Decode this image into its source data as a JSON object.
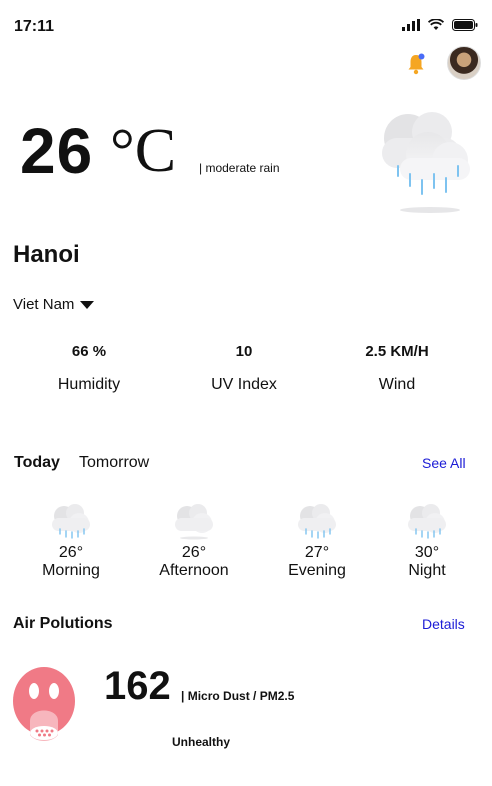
{
  "status_bar": {
    "time": "17:11"
  },
  "weather": {
    "temperature": "26",
    "unit": "°C",
    "condition": "| moderate rain",
    "city": "Hanoi",
    "country": "Viet Nam"
  },
  "stats": [
    {
      "value": "66 %",
      "label": "Humidity"
    },
    {
      "value": "10",
      "label": "UV Index"
    },
    {
      "value": "2.5 KM/H",
      "label": "Wind"
    }
  ],
  "tabs": {
    "today": "Today",
    "tomorrow": "Tomorrow",
    "see_all": "See All"
  },
  "forecast": [
    {
      "temp": "26°",
      "period": "Morning",
      "icon": "rain-cloud-icon"
    },
    {
      "temp": "26°",
      "period": "Afternoon",
      "icon": "cloud-icon"
    },
    {
      "temp": "27°",
      "period": "Evening",
      "icon": "rain-cloud-icon"
    },
    {
      "temp": "30°",
      "period": "Night",
      "icon": "rain-cloud-icon"
    }
  ],
  "air": {
    "title": "Air Polutions",
    "details": "Details",
    "value": "162",
    "type": "| Micro Dust / PM2.5",
    "level": "Unhealthy",
    "level_color": "#f07a86"
  },
  "colors": {
    "link": "#1b1bd6",
    "bell": "#f5a623",
    "notification_dot": "#4a6cf7",
    "rain": "#7ec3f0"
  }
}
